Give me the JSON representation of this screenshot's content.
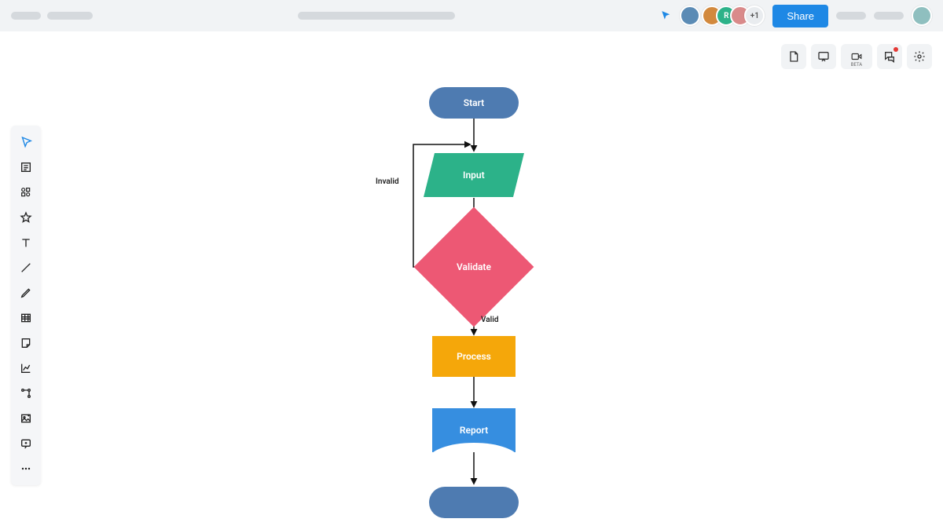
{
  "header": {
    "share_label": "Share",
    "avatar_overflow": "+1"
  },
  "upper_right": {
    "beta_label": "BETA"
  },
  "flowchart": {
    "nodes": {
      "start": "Start",
      "input": "Input",
      "validate": "Validate",
      "process": "Process",
      "report": "Report"
    },
    "edges": {
      "invalid": "Invalid",
      "valid": "Valid"
    }
  }
}
